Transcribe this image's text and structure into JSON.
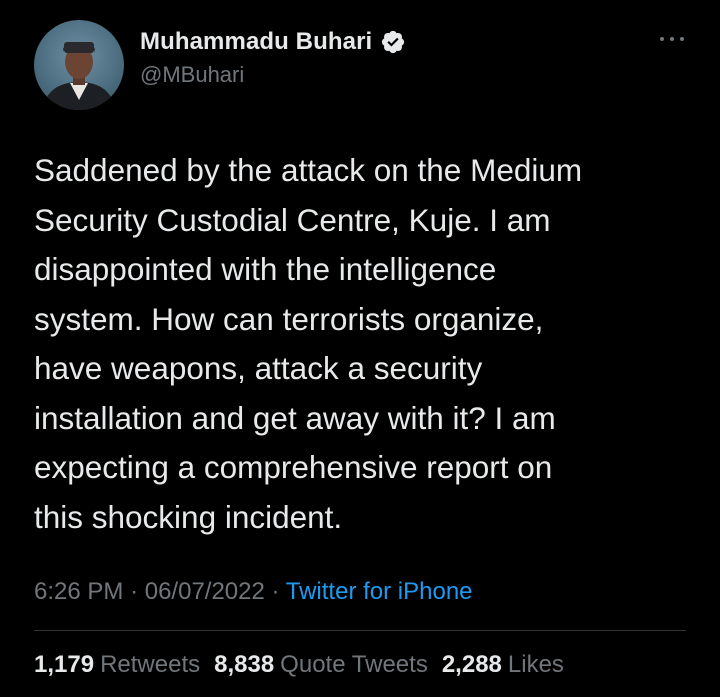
{
  "author": {
    "name": "Muhammadu Buhari",
    "handle": "@MBuhari",
    "verified": true
  },
  "tweet": {
    "text": "Saddened by the attack on the Medium\nSecurity Custodial Centre, Kuje. I am\ndisappointed with the intelligence\nsystem. How can terrorists organize,\nhave weapons, attack a security\ninstallation and get away with it? I am\nexpecting a comprehensive report on\nthis shocking incident.",
    "time": "6:26 PM",
    "date": "06/07/2022",
    "separator": "·",
    "source": "Twitter for iPhone"
  },
  "stats": {
    "retweets_count": "1,179",
    "retweets_label": "Retweets",
    "quotes_count": "8,838",
    "quotes_label": "Quote Tweets",
    "likes_count": "2,288",
    "likes_label": "Likes"
  },
  "colors": {
    "background": "#000000",
    "text": "#e7e9ea",
    "secondary": "#71767b",
    "link": "#1d9bf0",
    "divider": "#2f3336"
  },
  "icons": {
    "verified": "verified-badge-icon",
    "more": "more-options-icon"
  }
}
